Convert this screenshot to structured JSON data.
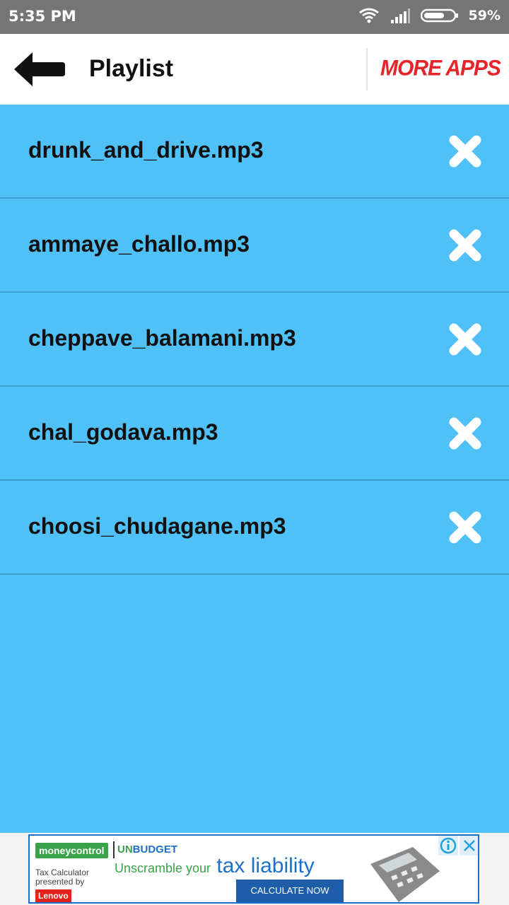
{
  "status_bar": {
    "time": "5:35 PM",
    "battery_percent": "59%",
    "icons": [
      "wifi-icon",
      "signal-icon",
      "battery-icon"
    ]
  },
  "app_bar": {
    "back_icon": "back-arrow-icon",
    "title": "Playlist",
    "more_apps": "MORE APPS"
  },
  "playlist": {
    "items": [
      {
        "name": "drunk_and_drive.mp3",
        "delete_icon": "close-icon"
      },
      {
        "name": "ammaye_challo.mp3",
        "delete_icon": "close-icon"
      },
      {
        "name": "cheppave_balamani.mp3",
        "delete_icon": "close-icon"
      },
      {
        "name": "chal_godava.mp3",
        "delete_icon": "close-icon"
      },
      {
        "name": "choosi_chudagane.mp3",
        "delete_icon": "close-icon"
      }
    ]
  },
  "ad": {
    "brand": "moneycontrol",
    "un": "UN",
    "budget": "BUDGET",
    "sub_line1": "Tax Calculator",
    "sub_line2": "presented by",
    "sponsor": "Lenovo",
    "headline_pre": "Unscramble your",
    "headline_main": "tax liability",
    "cta": "CALCULATE NOW",
    "icons": [
      "info-icon",
      "close-icon",
      "calculator-icon"
    ]
  },
  "colors": {
    "list_background": "#4fc1f7",
    "status_bar": "#757575",
    "more_apps": "#e8242b",
    "divider": "#3aa0d0"
  }
}
